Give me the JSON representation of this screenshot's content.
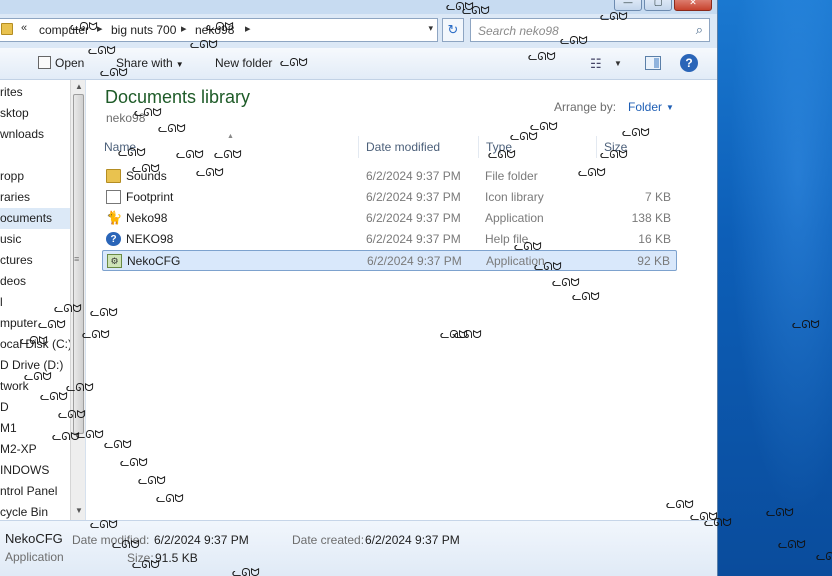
{
  "window": {
    "caption_buttons": {
      "minimize": "—",
      "maximize": "▢",
      "close": "✕"
    }
  },
  "address": {
    "overflow": "«",
    "crumbs": [
      "computer",
      "big nuts 700",
      "neko98"
    ],
    "separator": "▸",
    "dropdown": "▾",
    "refresh": "↻",
    "search_placeholder": "Search neko98",
    "search_icon": "⌕"
  },
  "toolbar": {
    "open_label": "Open",
    "share_label": "Share with",
    "new_folder_label": "New folder",
    "dropdown_arrow": "▼",
    "views_icon": "☷",
    "help_label": "?"
  },
  "nav": {
    "items": [
      {
        "label": "rites",
        "selected": false
      },
      {
        "label": "sktop",
        "selected": false
      },
      {
        "label": "wnloads",
        "selected": false
      },
      {
        "label": "",
        "selected": false
      },
      {
        "label": "ropp",
        "selected": false
      },
      {
        "label": "raries",
        "selected": false
      },
      {
        "label": "ocuments",
        "selected": true
      },
      {
        "label": "usic",
        "selected": false
      },
      {
        "label": "ctures",
        "selected": false
      },
      {
        "label": "deos",
        "selected": false
      },
      {
        "label": "l",
        "selected": false
      },
      {
        "label": "mputer",
        "selected": false
      },
      {
        "label": "ocal Disk (C:)",
        "selected": false
      },
      {
        "label": "D Drive (D:)",
        "selected": false
      },
      {
        "label": "twork",
        "selected": false
      },
      {
        "label": "D",
        "selected": false
      },
      {
        "label": "M1",
        "selected": false
      },
      {
        "label": "M2-XP",
        "selected": false
      },
      {
        "label": "INDOWS",
        "selected": false
      },
      {
        "label": "ntrol Panel",
        "selected": false
      },
      {
        "label": "cycle Bin",
        "selected": false
      }
    ]
  },
  "library": {
    "title": "Documents library",
    "subtitle": "neko98",
    "arrange_label": "Arrange by:",
    "arrange_value": "Folder"
  },
  "columns": {
    "name": "Name",
    "date": "Date modified",
    "type": "Type",
    "size": "Size"
  },
  "files": [
    {
      "icon": "folder-icon",
      "name": "Sounds",
      "date": "6/2/2024 9:37 PM",
      "type": "File folder",
      "size": "",
      "selected": false
    },
    {
      "icon": "file-icon",
      "name": "Footprint",
      "date": "6/2/2024 9:37 PM",
      "type": "Icon library",
      "size": "7 KB",
      "selected": false
    },
    {
      "icon": "cat-icon",
      "name": "Neko98",
      "date": "6/2/2024 9:37 PM",
      "type": "Application",
      "size": "138 KB",
      "selected": false
    },
    {
      "icon": "help-file-icon",
      "name": "NEKO98",
      "date": "6/2/2024 9:37 PM",
      "type": "Help file",
      "size": "16 KB",
      "selected": false
    },
    {
      "icon": "config-app-icon",
      "name": "NekoCFG",
      "date": "6/2/2024 9:37 PM",
      "type": "Application",
      "size": "92 KB",
      "selected": true
    }
  ],
  "details": {
    "name": "NekoCFG",
    "kind": "Application",
    "date_modified_label": "Date modified:",
    "date_modified": "6/2/2024 9:37 PM",
    "date_created_label": "Date created:",
    "date_created": "6/2/2024 9:37 PM",
    "size_label": "Size:",
    "size": "91.5 KB"
  },
  "sprites": {
    "neko": "ᓚᘏᗢ"
  },
  "colors": {
    "library_title": "#1e5b28",
    "selection": "#d9e8fb",
    "desktop": "#0d5fb8",
    "link": "#1f5fb5"
  }
}
